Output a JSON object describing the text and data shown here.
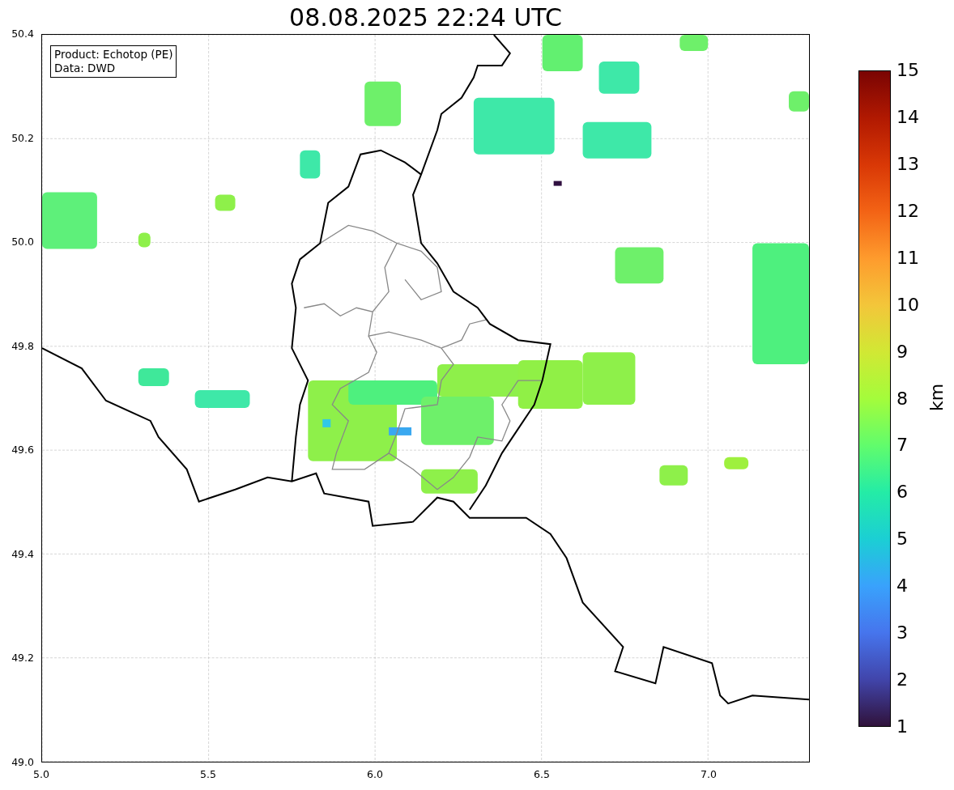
{
  "title": "08.08.2025 22:24 UTC",
  "legend": [
    "Product: Echotop (PE)",
    "Data: DWD"
  ],
  "y_ticks": [
    "50.4",
    "50.2",
    "50.0",
    "49.8",
    "49.6",
    "49.4",
    "49.2",
    "49.0"
  ],
  "x_ticks": [
    "5.0",
    "5.5",
    "6.0",
    "6.5",
    "7.0"
  ],
  "colorbar": {
    "label": "km",
    "ticks": [
      "15",
      "14",
      "13",
      "12",
      "11",
      "10",
      "9",
      "8",
      "7",
      "6",
      "5",
      "4",
      "3",
      "2",
      "1"
    ]
  }
}
